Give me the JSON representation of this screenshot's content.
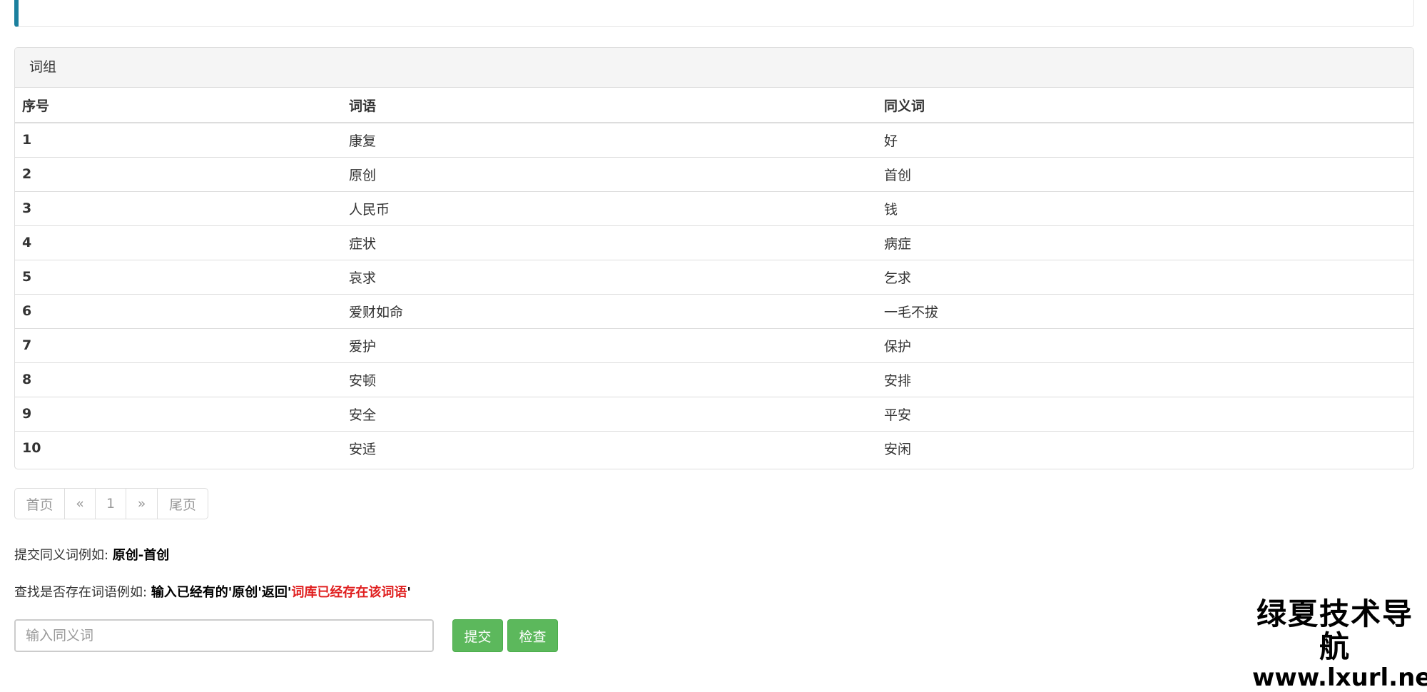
{
  "panel": {
    "title": "词组"
  },
  "table": {
    "headers": [
      "序号",
      "词语",
      "同义词"
    ],
    "rows": [
      [
        "1",
        "康复",
        "好"
      ],
      [
        "2",
        "原创",
        "首创"
      ],
      [
        "3",
        "人民币",
        "钱"
      ],
      [
        "4",
        "症状",
        "病症"
      ],
      [
        "5",
        "哀求",
        "乞求"
      ],
      [
        "6",
        "爱财如命",
        "一毛不拔"
      ],
      [
        "7",
        "爱护",
        "保护"
      ],
      [
        "8",
        "安顿",
        "安排"
      ],
      [
        "9",
        "安全",
        "平安"
      ],
      [
        "10",
        "安适",
        "安闲"
      ]
    ]
  },
  "pagination": {
    "first": "首页",
    "prev": "«",
    "current": "1",
    "next": "»",
    "last": "尾页"
  },
  "hints": {
    "submit_prefix": "提交同义词例如: ",
    "submit_example": "原创-首创",
    "check_prefix": "查找是否存在词语例如: ",
    "check_example": "输入已经有的'原创'返回'",
    "check_result": "词库已经存在该词语",
    "check_suffix": "'"
  },
  "form": {
    "placeholder": "输入同义词",
    "value": "",
    "submit_label": "提交",
    "check_label": "检查"
  },
  "watermark": {
    "line1": "绿夏技术导航",
    "line2": "www.lxurl.net"
  },
  "colors": {
    "accent_border": "#1b809e",
    "success": "#5cb85c",
    "highlight": "#e02020"
  }
}
